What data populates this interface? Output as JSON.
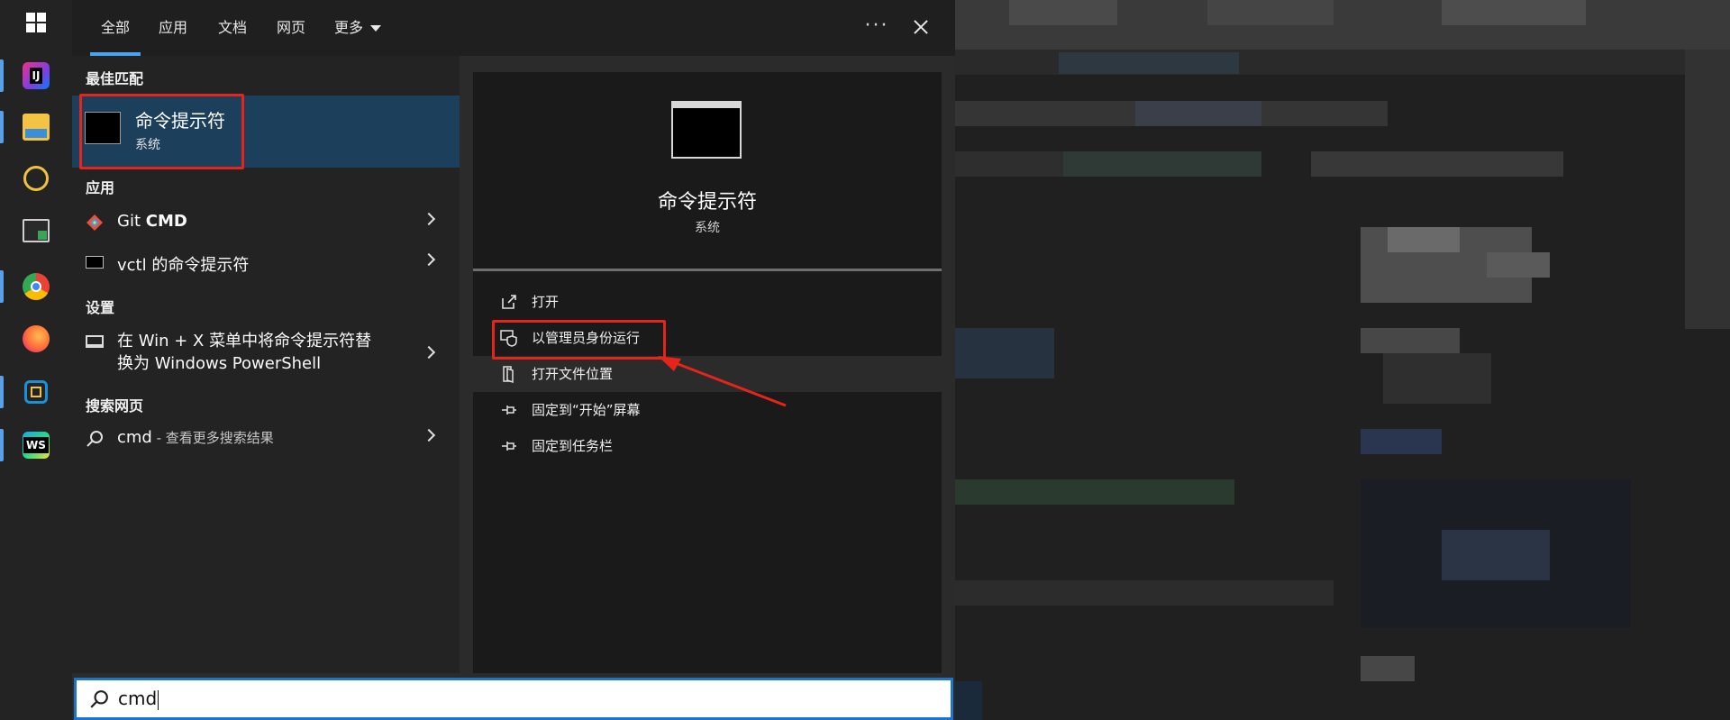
{
  "taskbar": {
    "apps": [
      {
        "name": "windows-start",
        "label": ""
      },
      {
        "name": "intellij",
        "label": "IJ",
        "color": "#7b3fe4"
      },
      {
        "name": "file-explorer",
        "label": "",
        "color": "#f3c343"
      },
      {
        "name": "navicat",
        "label": "",
        "color": "#f0c040"
      },
      {
        "name": "terminal",
        "label": "",
        "color": "#3aa35a"
      },
      {
        "name": "chrome",
        "label": "",
        "color": "#4285f4"
      },
      {
        "name": "firefox",
        "label": "",
        "color": "#ff7139"
      },
      {
        "name": "virtualbox",
        "label": "",
        "color": "#1c8fd6"
      },
      {
        "name": "webstorm",
        "label": "WS",
        "color": "#1aa7e5"
      }
    ]
  },
  "tabs": [
    "全部",
    "应用",
    "文档",
    "网页",
    "更多"
  ],
  "more_dots": "···",
  "sections": {
    "best_match": "最佳匹配",
    "apps": "应用",
    "settings": "设置",
    "web": "搜索网页"
  },
  "best_match": {
    "name": "命令提示符",
    "sub": "系统"
  },
  "apps": [
    {
      "label_prefix": "Git ",
      "label_bold": "CMD"
    },
    {
      "label_prefix": "vctl 的命令提示符",
      "label_bold": ""
    }
  ],
  "settings_item": {
    "line1": "在 Win + X 菜单中将命令提示符替",
    "line2": "换为 Windows PowerShell"
  },
  "web_item": {
    "query": "cmd",
    "suffix": " - 查看更多搜索结果"
  },
  "detail": {
    "title": "命令提示符",
    "sub": "系统"
  },
  "actions": [
    "打开",
    "以管理员身份运行",
    "打开文件位置",
    "固定到“开始”屏幕",
    "固定到任务栏"
  ],
  "search": {
    "value": "cmd"
  },
  "colors": {
    "accent": "#4aa3f0",
    "highlight": "#1c3f5c",
    "annotation": "#e5241c"
  }
}
